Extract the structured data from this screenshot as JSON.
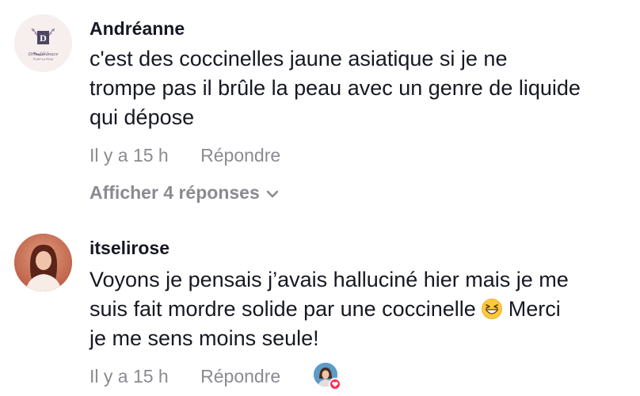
{
  "comments": [
    {
      "username": "Andréanne",
      "avatar_text": "D",
      "avatar_brand": "Droudilidouce",
      "avatar_tagline": "POUR LA PEAU",
      "lines": [
        "c'est des coccinelles jaune asiatique si je ne",
        "trompe pas il brûle la peau avec un genre de liquide",
        "qui dépose"
      ],
      "time": "Il y a 15 h",
      "reply_label": "Répondre",
      "show_replies": "Afficher 4 réponses"
    },
    {
      "username": "itselirose",
      "lines": [
        "Voyons je pensais j’avais halluciné hier mais je me",
        "suis fait mordre solide par une coccinelle",
        "je me sens moins seule!"
      ],
      "line2_after_emoji": "Merci",
      "emoji": "grinning-squinting-face",
      "time": "Il y a 15 h",
      "reply_label": "Répondre",
      "creator_liked": true
    }
  ],
  "colors": {
    "text": "#161823",
    "meta": "#8a8b91",
    "like_heart": "#fe2c55"
  },
  "icons": [
    "chevron-down-icon",
    "emoji-grinning-squinting",
    "heart-icon"
  ]
}
